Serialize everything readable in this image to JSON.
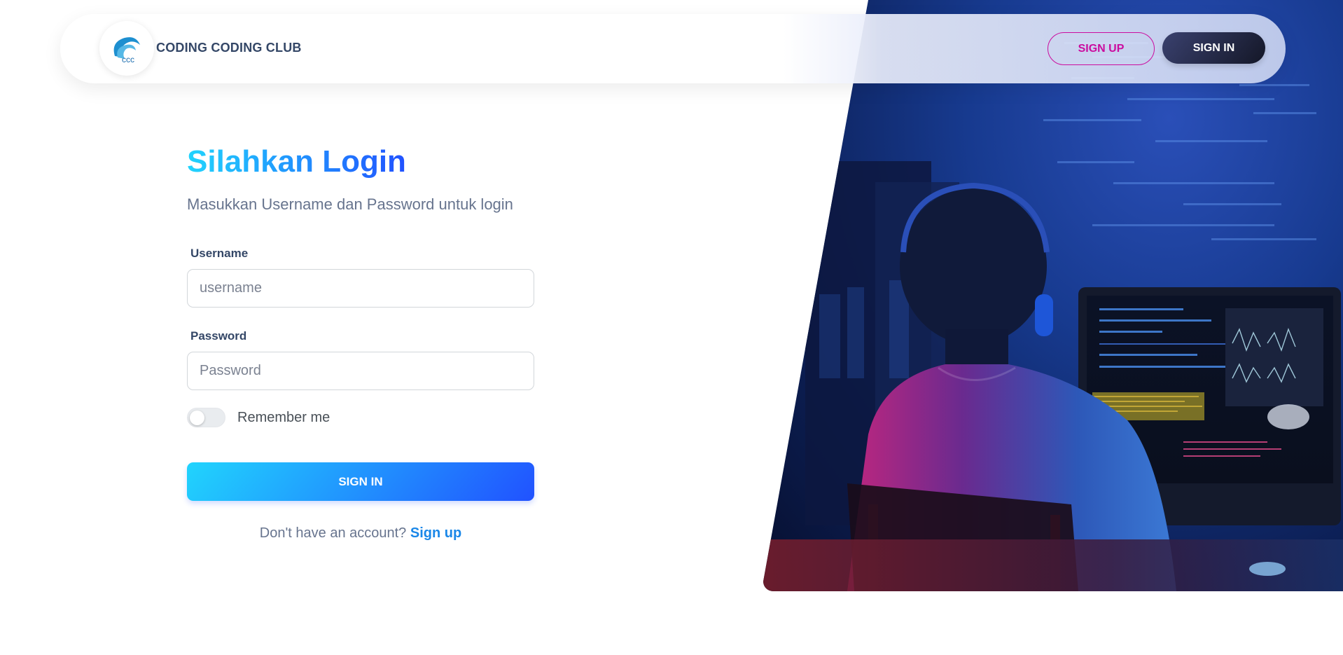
{
  "navbar": {
    "logo_text": "ccc",
    "brand": "CODING CODING CLUB",
    "signup_label": "SIGN UP",
    "signin_label": "SIGN IN"
  },
  "login": {
    "title": "Silahkan Login",
    "subtitle": "Masukkan Username dan Password untuk login",
    "username_label": "Username",
    "username_placeholder": "username",
    "password_label": "Password",
    "password_placeholder": "Password",
    "remember_label": "Remember me",
    "remember_checked": false,
    "submit_label": "SIGN IN",
    "footer_prompt": "Don't have an account?",
    "footer_link": "Sign up"
  },
  "colors": {
    "accent_gradient_start": "#21d4fd",
    "accent_gradient_end": "#2152ff",
    "signup_outline": "#cb0c9f",
    "dark_button": "#141727"
  },
  "icons": {
    "logo": "ccc-wave-logo-icon"
  }
}
